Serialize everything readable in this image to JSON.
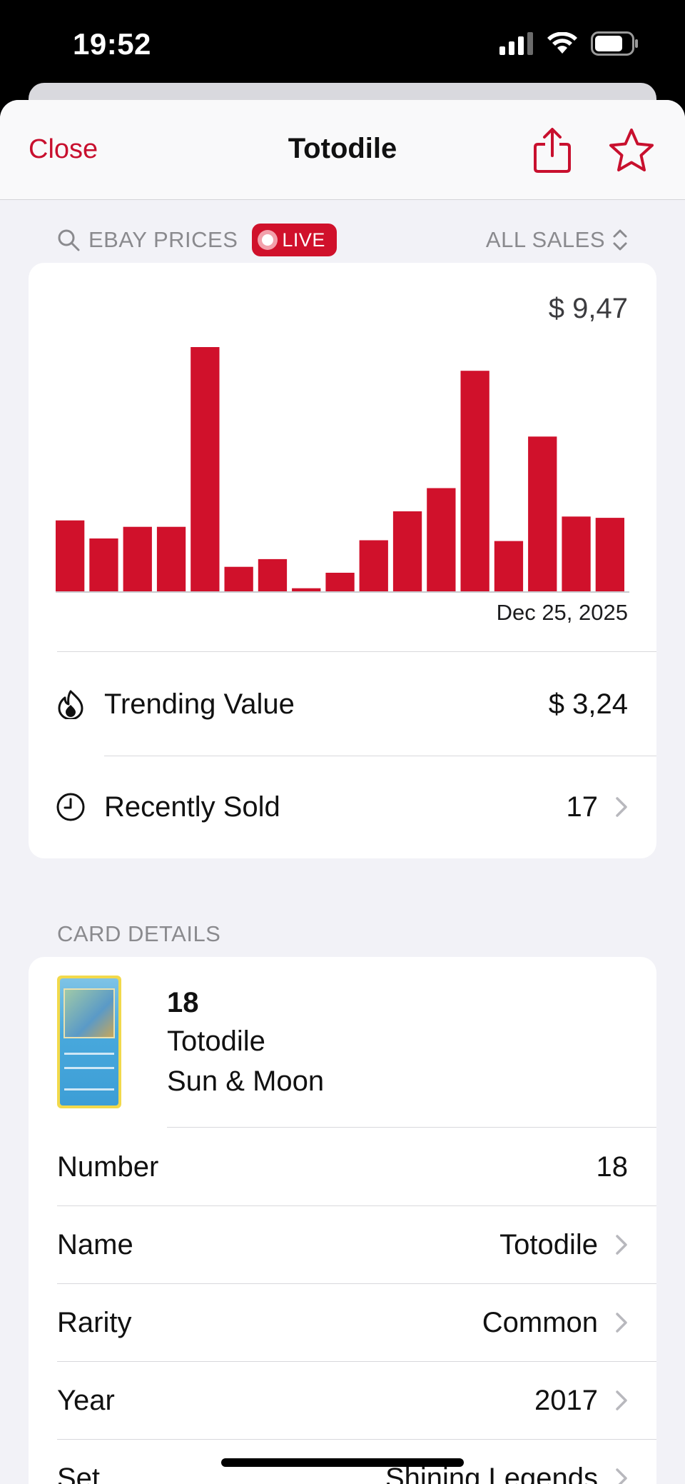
{
  "status_bar": {
    "time": "19:52"
  },
  "nav": {
    "close_label": "Close",
    "title": "Totodile"
  },
  "prices_section": {
    "label": "EBAY PRICES",
    "live_label": "LIVE",
    "filter_label": "ALL SALES"
  },
  "chart_data": {
    "type": "bar",
    "max_label": "$ 9,47",
    "date_label": "Dec 25, 2025",
    "values": [
      2.75,
      2.05,
      2.5,
      2.5,
      9.47,
      0.95,
      1.25,
      0.12,
      0.72,
      1.98,
      3.1,
      4.0,
      8.55,
      1.95,
      6.0,
      2.9,
      2.85
    ],
    "ylim": [
      0,
      9.47
    ],
    "color": "#d0112b"
  },
  "price_rows": [
    {
      "label": "Trending Value",
      "value": "$ 3,24",
      "icon": "flame-icon"
    },
    {
      "label": "Recently Sold",
      "value": "17",
      "icon": "clock-icon"
    }
  ],
  "details_section": {
    "label": "CARD DETAILS"
  },
  "card_identity": {
    "number": "18",
    "name": "Totodile",
    "series": "Sun & Moon"
  },
  "detail_rows": [
    {
      "label": "Number",
      "value": "18"
    },
    {
      "label": "Name",
      "value": "Totodile"
    },
    {
      "label": "Rarity",
      "value": "Common"
    },
    {
      "label": "Year",
      "value": "2017"
    },
    {
      "label": "Set",
      "value": "Shining Legends"
    }
  ],
  "colors": {
    "accent": "#c8102e",
    "background": "#f2f2f7"
  }
}
